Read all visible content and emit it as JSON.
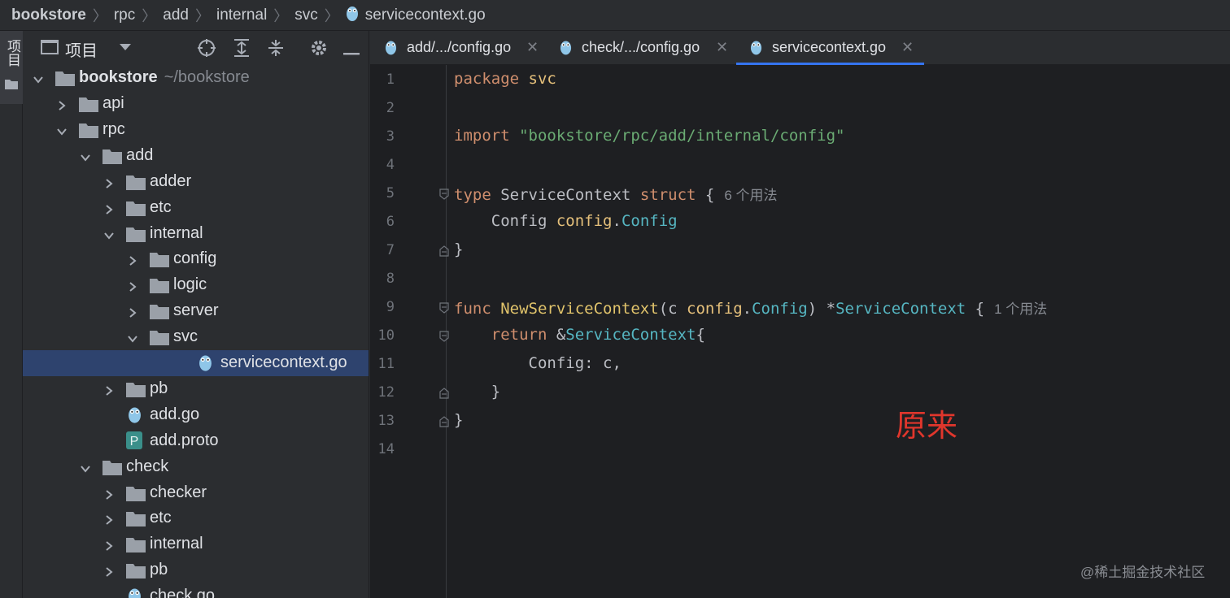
{
  "breadcrumb": [
    "bookstore",
    "rpc",
    "add",
    "internal",
    "svc",
    "servicecontext.go"
  ],
  "stripe": {
    "label": "项目"
  },
  "project_panel": {
    "title": "项目",
    "root_label": "bookstore",
    "root_path": "~/bookstore",
    "items": [
      {
        "label": "api",
        "type": "folder",
        "expanded": false
      },
      {
        "label": "rpc",
        "type": "folder",
        "expanded": true
      },
      {
        "label": "add",
        "type": "folder",
        "expanded": true
      },
      {
        "label": "adder",
        "type": "folder",
        "expanded": false
      },
      {
        "label": "etc",
        "type": "folder",
        "expanded": false
      },
      {
        "label": "internal",
        "type": "folder",
        "expanded": true
      },
      {
        "label": "config",
        "type": "folder",
        "expanded": false
      },
      {
        "label": "logic",
        "type": "folder",
        "expanded": false
      },
      {
        "label": "server",
        "type": "folder",
        "expanded": false
      },
      {
        "label": "svc",
        "type": "folder",
        "expanded": true
      },
      {
        "label": "servicecontext.go",
        "type": "go-file",
        "selected": true
      },
      {
        "label": "pb",
        "type": "folder",
        "expanded": false
      },
      {
        "label": "add.go",
        "type": "go-file"
      },
      {
        "label": "add.proto",
        "type": "proto-file"
      },
      {
        "label": "check",
        "type": "folder",
        "expanded": true
      },
      {
        "label": "checker",
        "type": "folder",
        "expanded": false
      },
      {
        "label": "etc",
        "type": "folder",
        "expanded": false
      },
      {
        "label": "internal",
        "type": "folder",
        "expanded": false
      },
      {
        "label": "pb",
        "type": "folder",
        "expanded": false
      },
      {
        "label": "check.go",
        "type": "go-file"
      }
    ]
  },
  "tabs": [
    {
      "label": "add/.../config.go",
      "active": false
    },
    {
      "label": "check/.../config.go",
      "active": false
    },
    {
      "label": "servicecontext.go",
      "active": true
    }
  ],
  "editor": {
    "line_numbers": [
      "1",
      "2",
      "3",
      "4",
      "5",
      "6",
      "7",
      "8",
      "9",
      "10",
      "11",
      "12",
      "13",
      "14"
    ],
    "code": {
      "l1_kw": "package",
      "l1_name": "svc",
      "l3_kw": "import",
      "l3_str": "\"bookstore/rpc/add/internal/config\"",
      "l5_kw": "type",
      "l5_name": "ServiceContext",
      "l5_kw2": "struct",
      "l5_brace": "{",
      "l5_hint": "6 个用法",
      "l6_field": "Config",
      "l6_pkg": "config",
      "l6_dot": ".",
      "l6_type": "Config",
      "l7": "}",
      "l9_kw": "func",
      "l9_fn": "NewServiceContext",
      "l9_open": "(c ",
      "l9_pkg": "config",
      "l9_dot": ".",
      "l9_type": "Config",
      "l9_close": ") *",
      "l9_ret": "ServiceContext",
      "l9_brace": " {",
      "l9_hint": "1 个用法",
      "l10_kw": "return",
      "l10_amp": " &",
      "l10_type": "ServiceContext",
      "l10_brace": "{",
      "l11": "Config: c,",
      "l12": "}",
      "l13": "}"
    }
  },
  "overlay_text": "原来",
  "watermark": "@稀土掘金技术社区",
  "colors": {
    "accent": "#3574f0",
    "selection": "#2e436e",
    "overlay_red": "#e0362c"
  }
}
